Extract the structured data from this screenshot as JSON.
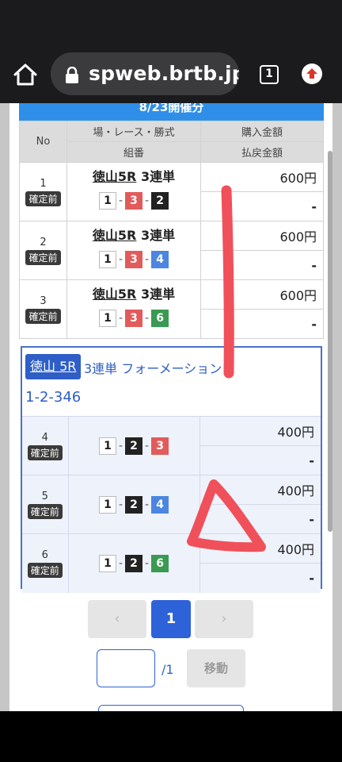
{
  "browser": {
    "url": "spweb.brtb.jp/",
    "tab_count": "1"
  },
  "banner": {
    "title": "8/23開催分"
  },
  "table_header": {
    "no": "No",
    "race_info": "場・レース・勝式",
    "combination": "組番",
    "purchase_amount": "購入金額",
    "payout_amount": "払戻金額"
  },
  "bets": [
    {
      "no": "1",
      "status": "確定前",
      "venue": "徳山5R",
      "bet_type": "3連単",
      "combo": [
        "1",
        "3",
        "2"
      ],
      "amount": "600円",
      "payout": "-"
    },
    {
      "no": "2",
      "status": "確定前",
      "venue": "徳山5R",
      "bet_type": "3連単",
      "combo": [
        "1",
        "3",
        "4"
      ],
      "amount": "600円",
      "payout": "-"
    },
    {
      "no": "3",
      "status": "確定前",
      "venue": "徳山5R",
      "bet_type": "3連単",
      "combo": [
        "1",
        "3",
        "6"
      ],
      "amount": "600円",
      "payout": "-"
    }
  ],
  "formation": {
    "venue": "徳山 5R",
    "bet_type": "3連単 フォーメーション",
    "combo_text": "1-2-346",
    "rows": [
      {
        "no": "4",
        "status": "確定前",
        "combo": [
          "1",
          "2",
          "3"
        ],
        "amount": "400円",
        "payout": "-"
      },
      {
        "no": "5",
        "status": "確定前",
        "combo": [
          "1",
          "2",
          "4"
        ],
        "amount": "400円",
        "payout": "-"
      },
      {
        "no": "6",
        "status": "確定前",
        "combo": [
          "1",
          "2",
          "6"
        ],
        "amount": "400円",
        "payout": "-"
      }
    ]
  },
  "pagination": {
    "prev": "‹",
    "current": "1",
    "next": "›",
    "total": "/1",
    "jump_label": "移動"
  },
  "colors": {
    "boat_1": "#ffffff",
    "boat_2": "#222222",
    "boat_3": "#e25b5b",
    "boat_4": "#4b86e0",
    "boat_6": "#3a9a52",
    "accent": "#2e62d8",
    "annotation": "#f0505a"
  }
}
